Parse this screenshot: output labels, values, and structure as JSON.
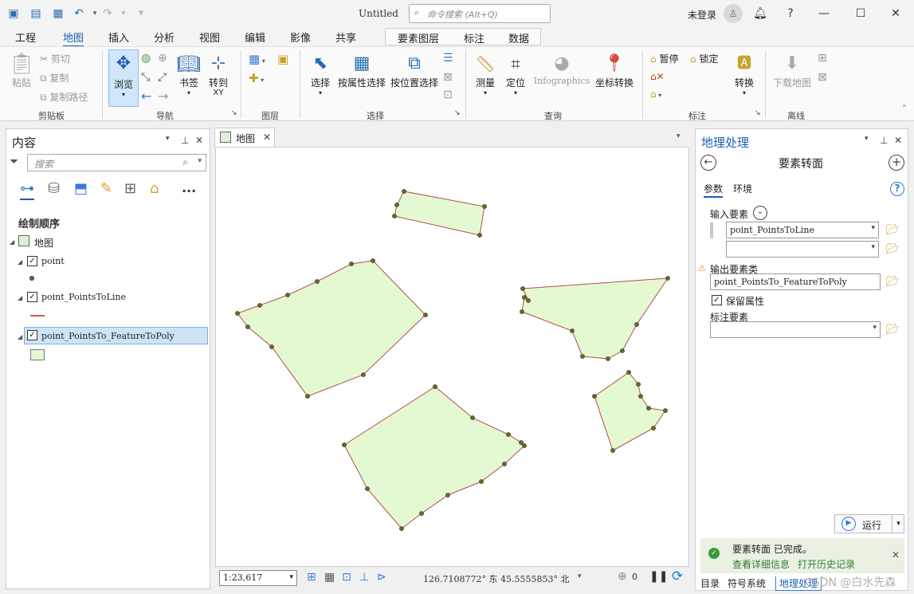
{
  "window": {
    "title": "Untitled",
    "search_placeholder": "命令搜索 (Alt+Q)",
    "user": "未登录",
    "help": "?"
  },
  "tabs": {
    "t0": "工程",
    "t1": "地图",
    "t2": "插入",
    "t3": "分析",
    "t4": "视图",
    "t5": "编辑",
    "t6": "影像",
    "t7": "共享",
    "c0": "要素图层",
    "c1": "标注",
    "c2": "数据"
  },
  "ribbon": {
    "paste": "粘贴",
    "cut": "剪切",
    "copy": "复制",
    "copy_path": "复制路径",
    "g_clipboard": "剪贴板",
    "explore": "浏览",
    "bookmarks": "书签",
    "goto1": "转到",
    "goto2": "XY",
    "g_nav": "导航",
    "g_layer": "图层",
    "select": "选择",
    "select_attr": "按属性选择",
    "select_loc": "按位置选择",
    "g_selection": "选择",
    "measure": "测量",
    "locate": "定位",
    "infographics": "Infographics",
    "convert_coord": "坐标转换",
    "g_inquiry": "查询",
    "pause": "暂停",
    "lock": "锁定",
    "convert": "转换",
    "g_labeling": "标注",
    "download_map": "下载地图",
    "g_offline": "离线"
  },
  "contents": {
    "title": "内容",
    "search_placeholder": "搜索",
    "draw_order": "绘制顺序",
    "map": "地图",
    "layer1": "point",
    "layer2": "point_PointsToLine",
    "layer3": "point_PointsTo_FeatureToPoly",
    "more": "..."
  },
  "map": {
    "tab": "地图",
    "scale": "1:23,617",
    "coords": "126.7108772° 东 45.5555853° 北",
    "badge": "0"
  },
  "gp": {
    "title": "地理处理",
    "tool": "要素转面",
    "tab_params": "参数",
    "tab_env": "环境",
    "in_label": "输入要素",
    "in_value": "point_PointsToLine",
    "out_label": "输出要素类",
    "out_value": "point_PointsTo_FeatureToPoly",
    "keep_attr": "保留属性",
    "label_feat": "标注要素",
    "run": "运行",
    "done": "要素转面 已完成。",
    "details": "查看详细信息",
    "history": "打开历史记录",
    "bt0": "目录",
    "bt1": "符号系统",
    "bt2": "地理处理"
  },
  "watermark": "CSDN @白水先森",
  "colors": {
    "accent": "#1a5fb4",
    "poly_fill": "#e4f9d2",
    "poly_stroke": "#b05050",
    "vertex": "#6b6b23"
  }
}
